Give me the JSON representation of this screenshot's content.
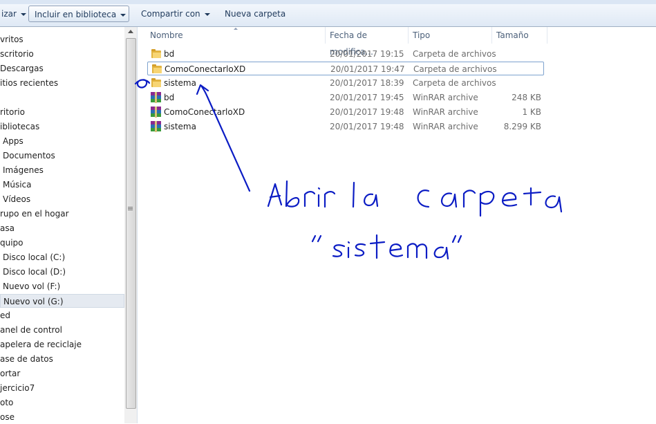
{
  "toolbar": {
    "organize_label": "izar",
    "include_library_label": "Incluir en biblioteca",
    "share_label": "Compartir con",
    "new_folder_label": "Nueva carpeta"
  },
  "nav": {
    "items": [
      {
        "label": "vritos",
        "indent": 0
      },
      {
        "label": "scritorio",
        "indent": 0
      },
      {
        "label": "Descargas",
        "indent": 0
      },
      {
        "label": "itios recientes",
        "indent": 0
      },
      {
        "label": "",
        "indent": 0
      },
      {
        "label": "ritorio",
        "indent": 0
      },
      {
        "label": "ibliotecas",
        "indent": 0
      },
      {
        "label": "Apps",
        "indent": 4
      },
      {
        "label": "Documentos",
        "indent": 4
      },
      {
        "label": "Imágenes",
        "indent": 4
      },
      {
        "label": "Música",
        "indent": 4
      },
      {
        "label": "Vídeos",
        "indent": 4
      },
      {
        "label": "rupo en el hogar",
        "indent": 0
      },
      {
        "label": "asa",
        "indent": 0
      },
      {
        "label": "quipo",
        "indent": 0
      },
      {
        "label": "Disco local (C:)",
        "indent": 4
      },
      {
        "label": "Disco local (D:)",
        "indent": 4
      },
      {
        "label": "Nuevo vol (F:)",
        "indent": 4
      },
      {
        "label": "Nuevo vol (G:)",
        "indent": 4,
        "selected": true
      },
      {
        "label": "ed",
        "indent": 0
      },
      {
        "label": "anel de control",
        "indent": 0
      },
      {
        "label": "apelera de reciclaje",
        "indent": 0
      },
      {
        "label": "ase de datos",
        "indent": 0
      },
      {
        "label": "ortar",
        "indent": 0
      },
      {
        "label": "jercicio7",
        "indent": 0
      },
      {
        "label": "oto",
        "indent": 0
      },
      {
        "label": "ose",
        "indent": 0
      }
    ]
  },
  "columns": {
    "name": "Nombre",
    "date": "Fecha de modifica...",
    "type": "Tipo",
    "size": "Tamaño"
  },
  "files": [
    {
      "name": "bd",
      "date": "20/01/2017 19:15",
      "type": "Carpeta de archivos",
      "size": "",
      "icon": "folder-icon"
    },
    {
      "name": "ComoConectarloXD",
      "date": "20/01/2017 19:47",
      "type": "Carpeta de archivos",
      "size": "",
      "icon": "folder-icon",
      "focused": true
    },
    {
      "name": "sistema",
      "date": "20/01/2017 18:39",
      "type": "Carpeta de archivos",
      "size": "",
      "icon": "folder-icon"
    },
    {
      "name": "bd",
      "date": "20/01/2017 19:45",
      "type": "WinRAR archive",
      "size": "248 KB",
      "icon": "winrar-icon"
    },
    {
      "name": "ComoConectarloXD",
      "date": "20/01/2017 19:48",
      "type": "WinRAR archive",
      "size": "1 KB",
      "icon": "winrar-icon"
    },
    {
      "name": "sistema",
      "date": "20/01/2017 19:48",
      "type": "WinRAR archive",
      "size": "8.299 KB",
      "icon": "winrar-icon"
    }
  ],
  "annotation": {
    "line1": "Abrir la carpeta",
    "line2": "\"sistema\"",
    "ink_color": "#0b1cc4"
  }
}
